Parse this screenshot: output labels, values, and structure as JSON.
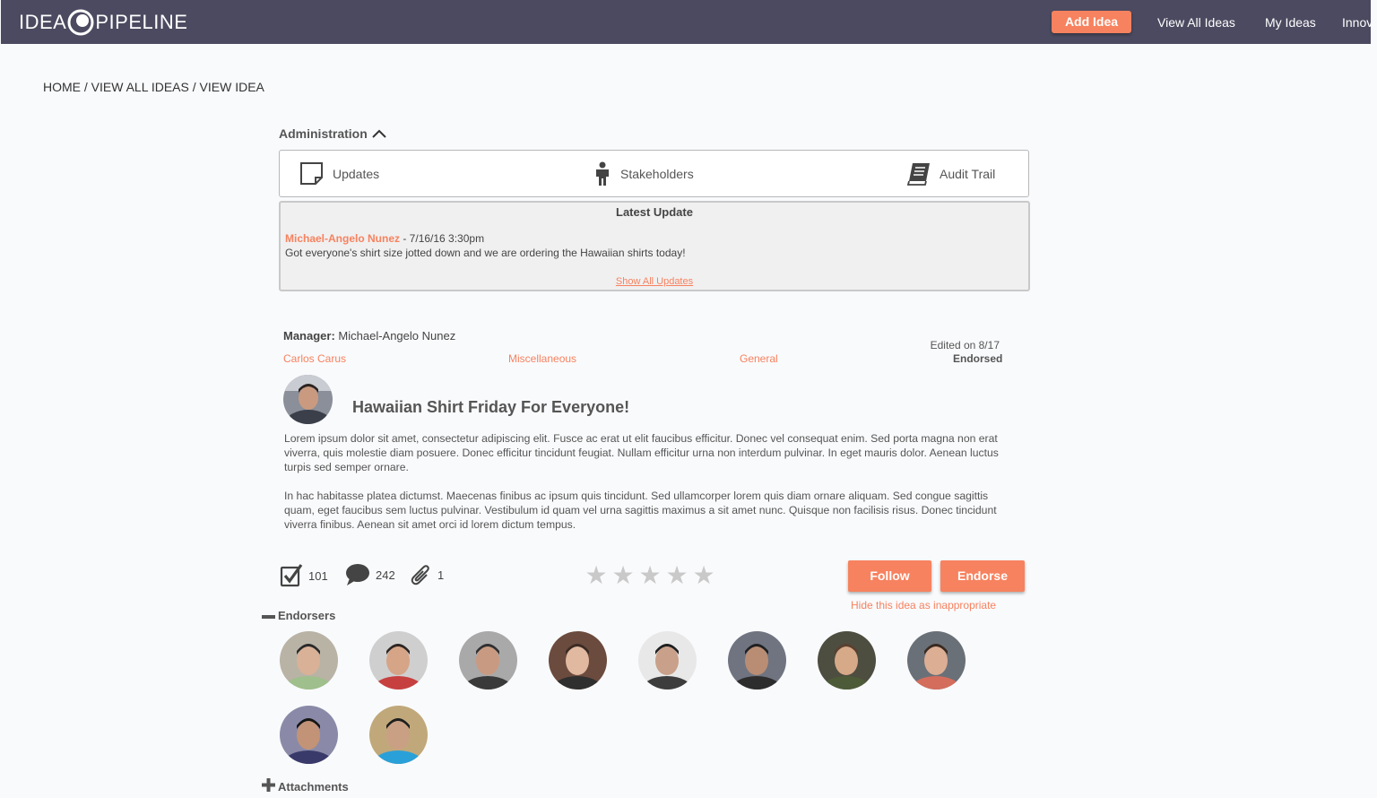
{
  "nav": {
    "logo_left": "IDEA",
    "logo_right": "PIPELINE",
    "add_idea": "Add Idea",
    "links": [
      "View All Ideas",
      "My Ideas",
      "Innov"
    ]
  },
  "breadcrumb": [
    "HOME",
    "VIEW ALL IDEAS",
    "VIEW IDEA"
  ],
  "administration": {
    "label": "Administration",
    "items": [
      {
        "label": "Updates",
        "icon": "note-icon"
      },
      {
        "label": "Stakeholders",
        "icon": "person-icon"
      },
      {
        "label": "Audit Trail",
        "icon": "book-icon"
      }
    ]
  },
  "latest_update": {
    "title": "Latest Update",
    "author": "Michael-Angelo Nunez",
    "date": " - 7/16/16 3:30pm",
    "text": "Got everyone's shirt size jotted down and we are ordering the Hawaiian shirts today!",
    "show_all": "Show All Updates"
  },
  "idea": {
    "manager_label": "Manager:",
    "manager_name": " Michael-Angelo Nunez",
    "submitter": "Carlos Carus",
    "category": "Miscellaneous",
    "type": "General",
    "edited": "Edited on 8/17",
    "status": "Endorsed",
    "title": "Hawaiian Shirt Friday For Everyone!",
    "body": [
      " Lorem ipsum dolor sit amet, consectetur adipiscing elit. Fusce ac erat ut elit faucibus efficitur. Donec vel consequat enim. Sed porta magna non erat viverra, quis molestie diam posuere. Donec efficitur tincidunt feugiat. Nullam efficitur urna non interdum pulvinar. In eget mauris dolor. Aenean luctus turpis sed semper ornare.",
      "In hac habitasse platea dictumst. Maecenas finibus ac ipsum quis tincidunt. Sed ullamcorper lorem quis diam ornare aliquam. Sed congue sagittis quam, eget faucibus sem luctus pulvinar. Vestibulum id quam vel urna sagittis maximus a sit amet nunc. Quisque non facilisis risus. Donec tincidunt viverra finibus. Aenean sit amet orci id lorem dictum tempus."
    ]
  },
  "stats": {
    "endorsements": "101",
    "comments": "242",
    "attachments": "1",
    "rating": 0,
    "rating_max": 5
  },
  "actions": {
    "follow": "Follow",
    "endorse": "Endorse",
    "hide": "Hide this idea as inappropriate"
  },
  "sections": {
    "endorsers": "Endorsers",
    "attachments": "Attachments"
  },
  "colors": {
    "accent": "#f7825f",
    "nav_bg": "#4b4a60"
  }
}
